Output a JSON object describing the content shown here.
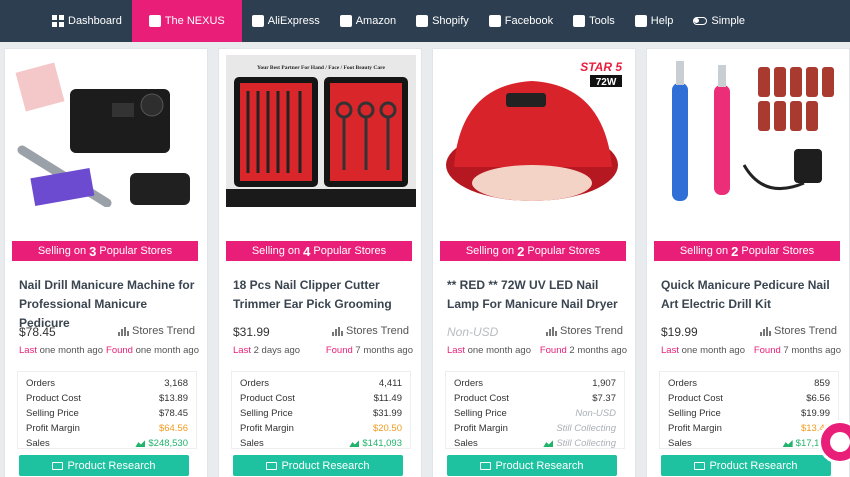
{
  "nav": {
    "items": [
      {
        "label": "Dashboard",
        "icon": "dashboard-icon",
        "active": false
      },
      {
        "label": "The NEXUS",
        "icon": "nexus-icon",
        "active": true
      },
      {
        "label": "AliExpress",
        "icon": "aliexpress-icon",
        "active": false
      },
      {
        "label": "Amazon",
        "icon": "amazon-icon",
        "active": false
      },
      {
        "label": "Shopify",
        "icon": "shopify-icon",
        "active": false
      },
      {
        "label": "Facebook",
        "icon": "facebook-icon",
        "active": false
      },
      {
        "label": "Tools",
        "icon": "tools-icon",
        "active": false
      },
      {
        "label": "Help",
        "icon": "help-icon",
        "active": false
      },
      {
        "label": "Simple",
        "icon": "toggle-icon",
        "active": false
      }
    ]
  },
  "colors": {
    "nav_bg": "#2d3e50",
    "accent": "#e91e78",
    "button": "#1ec2a1",
    "profit": "#f29b1d",
    "sales": "#21b36b"
  },
  "labels": {
    "stores_trend": "Stores Trend",
    "last": "Last",
    "found": "Found",
    "orders": "Orders",
    "product_cost": "Product Cost",
    "selling_price": "Selling Price",
    "profit_margin": "Profit Margin",
    "sales": "Sales",
    "product_research": "Product Research",
    "selling_on_prefix": "Selling on",
    "selling_on_suffix": "Popular Stores"
  },
  "cards": [
    {
      "stores": "3",
      "title": "Nail Drill Manicure Machine for Professional Manicure Pedicure",
      "price": "$78.45",
      "last": "one month ago",
      "found": "one month ago",
      "orders": "3,168",
      "product_cost": "$13.89",
      "selling_price": "$78.45",
      "profit_margin": "$64.56",
      "sales": "$248,530"
    },
    {
      "stores": "4",
      "title": "18 Pcs Nail Clipper Cutter Trimmer Ear Pick Grooming",
      "price": "$31.99",
      "last": "2 days ago",
      "found": "7 months ago",
      "orders": "4,411",
      "product_cost": "$11.49",
      "selling_price": "$31.99",
      "profit_margin": "$20.50",
      "sales": "$141,093",
      "image_text": "Your Best Partner For Hand / Face / Foot Beauty Care"
    },
    {
      "stores": "2",
      "title": "** RED ** 72W UV LED Nail Lamp For Manicure Nail Dryer",
      "price": "Non-USD",
      "last": "one month ago",
      "found": "2 months ago",
      "orders": "1,907",
      "product_cost": "$7.37",
      "selling_price": "Non-USD",
      "profit_margin": "Still Collecting",
      "sales": "Still Collecting",
      "image_text_a": "STAR 5",
      "image_text_b": "72W"
    },
    {
      "stores": "2",
      "title": "Quick Manicure Pedicure Nail Art Electric Drill Kit",
      "price": "$19.99",
      "last": "one month ago",
      "found": "7 months ago",
      "orders": "859",
      "product_cost": "$6.56",
      "selling_price": "$19.99",
      "profit_margin": "$13.43",
      "sales": "$17,176"
    }
  ]
}
